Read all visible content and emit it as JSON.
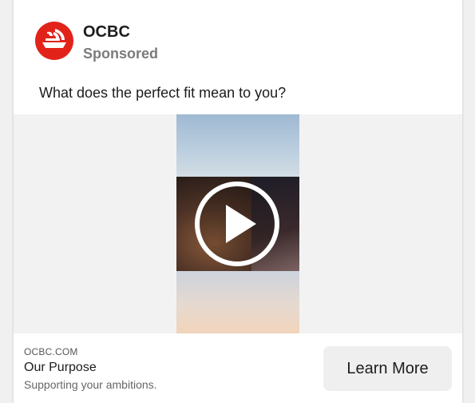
{
  "ad": {
    "brand_name": "OCBC",
    "sponsored_label": "Sponsored",
    "primary_text": "What does the perfect fit mean to you?",
    "logo_icon": "ocbc-logo",
    "play_icon": "play-icon",
    "link": {
      "domain": "OCBC.COM",
      "headline": "Our Purpose",
      "description": "Supporting your ambitions."
    },
    "cta_label": "Learn More"
  },
  "colors": {
    "brand_red": "#e2231a",
    "text": "#1c1c1c",
    "muted": "#7b7b7b",
    "cta_bg": "#efefef"
  }
}
